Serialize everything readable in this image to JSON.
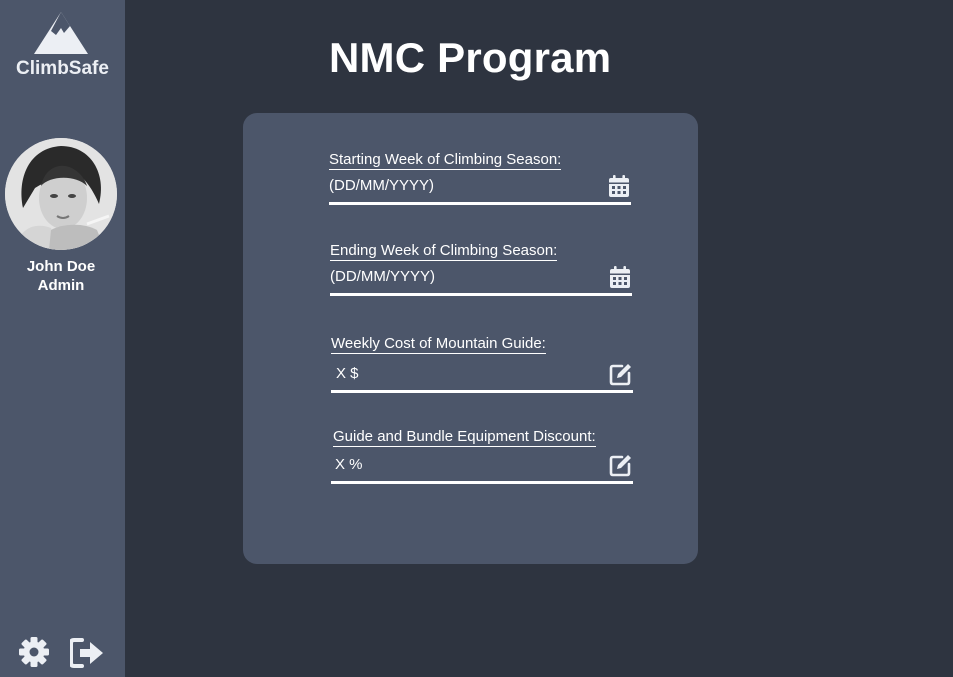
{
  "app": {
    "name": "ClimbSafe"
  },
  "icons": {
    "logo": "mountain-icon",
    "settings": "gear-icon",
    "logout": "sign-out-icon",
    "date": "calendar-icon",
    "edit": "edit-icon"
  },
  "colors": {
    "background": "#2e3440",
    "panel": "#4c566a",
    "text": "#ffffff"
  },
  "user": {
    "name": "John Doe",
    "role": "Admin"
  },
  "page": {
    "title": "NMC Program"
  },
  "form": {
    "start_week": {
      "label": "Starting Week of Climbing Season:",
      "value": "(DD/MM/YYYY)"
    },
    "end_week": {
      "label": "Ending Week of Climbing Season:",
      "value": "(DD/MM/YYYY)"
    },
    "guide_cost": {
      "label": "Weekly Cost of Mountain Guide:",
      "value": "X $"
    },
    "bundle_discount": {
      "label": "Guide and Bundle Equipment Discount:",
      "value": "X %"
    }
  }
}
